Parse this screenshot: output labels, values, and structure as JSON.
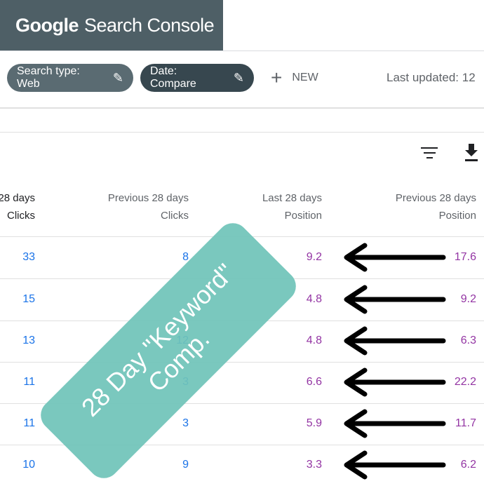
{
  "header": {
    "brand_google": "Google",
    "brand_product": "Search Console"
  },
  "filters": {
    "search_type": "Search type: Web",
    "date": "Date: Compare",
    "new_label": "NEW",
    "last_updated": "Last updated: 12"
  },
  "table": {
    "columns": [
      {
        "line1": "28 days",
        "line2": "Clicks"
      },
      {
        "line1": "Previous 28 days",
        "line2": "Clicks"
      },
      {
        "line1": "Last 28 days",
        "line2": "Position"
      },
      {
        "line1": "Previous 28 days",
        "line2": "Position"
      }
    ],
    "rows": [
      {
        "clicks": "33",
        "prev_clicks": "8",
        "position": "9.2",
        "prev_position": "17.6"
      },
      {
        "clicks": "15",
        "prev_clicks": "",
        "position": "4.8",
        "prev_position": "9.2"
      },
      {
        "clicks": "13",
        "prev_clicks": "12",
        "position": "4.8",
        "prev_position": "6.3"
      },
      {
        "clicks": "11",
        "prev_clicks": "3",
        "position": "6.6",
        "prev_position": "22.2"
      },
      {
        "clicks": "11",
        "prev_clicks": "3",
        "position": "5.9",
        "prev_position": "11.7"
      },
      {
        "clicks": "10",
        "prev_clicks": "9",
        "position": "3.3",
        "prev_position": "6.2"
      }
    ]
  },
  "overlay": {
    "line1": "28 Day \"Keyword\"",
    "line2": "Comp."
  },
  "icons": {
    "edit": "pencil-icon",
    "add": "plus-icon",
    "filter": "filter-icon",
    "download": "download-icon",
    "arrow": "left-arrow-icon"
  },
  "colors": {
    "brand_bg": "#4e5f66",
    "chip_web": "#5a6b72",
    "chip_date": "#37474f",
    "clicks_blue": "#1a73e8",
    "position_purple": "#9334a3",
    "overlay_teal": "#6fc3b9"
  }
}
